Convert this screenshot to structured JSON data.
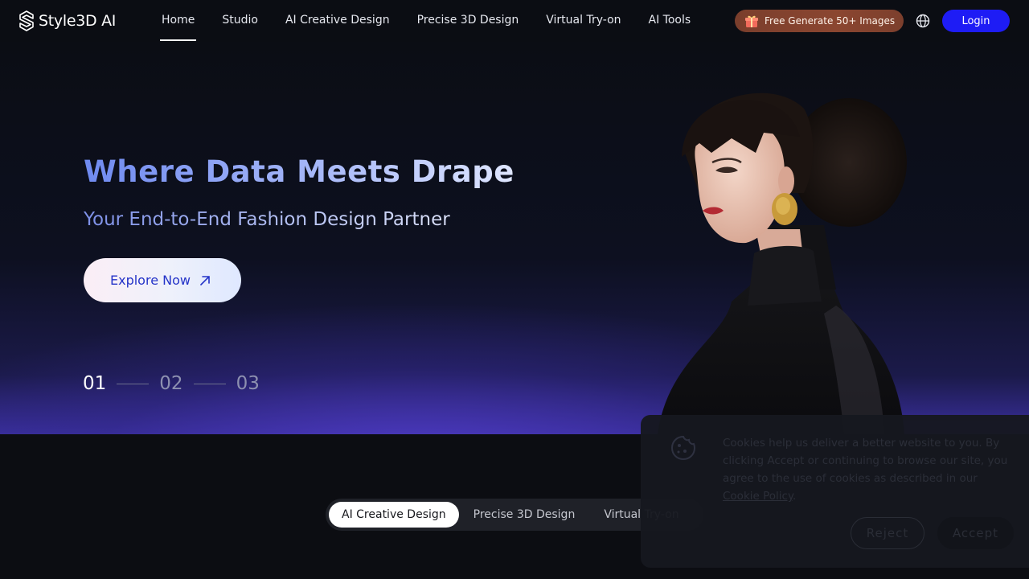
{
  "brand": {
    "logo_text": "Style3D AI"
  },
  "nav": {
    "items": [
      {
        "label": "Home",
        "active": true
      },
      {
        "label": "Studio"
      },
      {
        "label": "AI Creative Design"
      },
      {
        "label": "Precise 3D Design"
      },
      {
        "label": "Virtual Try-on"
      },
      {
        "label": "AI Tools"
      }
    ],
    "promo_label": "Free Generate 50+ Images",
    "login_label": "Login"
  },
  "hero": {
    "title": "Where Data Meets Drape",
    "subtitle": "Your End-to-End Fashion Design Partner",
    "cta_label": "Explore Now",
    "pager": [
      "01",
      "02",
      "03"
    ],
    "active_slide": "01"
  },
  "feature_tabs": [
    {
      "label": "AI Creative Design",
      "active": true
    },
    {
      "label": "Precise 3D Design"
    },
    {
      "label": "Virtual Try-on"
    }
  ],
  "cookie": {
    "text": "Cookies help us deliver a better website to you. By clicking Accept or continuing to browse our site, you agree to the use of cookies as described in our",
    "link_label": "Cookie Policy",
    "reject_label": "Reject",
    "accept_label": "Accept"
  },
  "colors": {
    "login_button": "#1e1cf5",
    "promo_badge": "#8b4630",
    "cta_text": "#2433c8"
  },
  "icons": [
    "logo-icon",
    "gift-icon",
    "globe-icon",
    "arrow-up-right-icon",
    "cookie-icon"
  ]
}
